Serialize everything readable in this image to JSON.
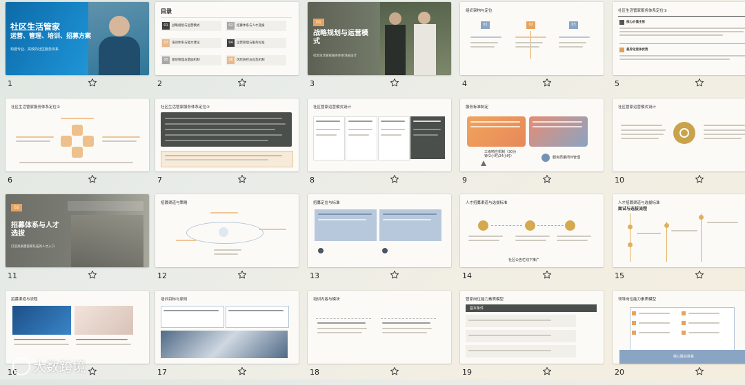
{
  "slides": [
    {
      "n": "1",
      "title": "社区生活管家",
      "subtitle": "运营、管理、培训、招募方案",
      "tag": "构建专业、高效的社区服务体系"
    },
    {
      "n": "2",
      "title": "目录",
      "items": [
        {
          "no": "01",
          "text": "战略规划与运营模式"
        },
        {
          "no": "02",
          "text": "招募体系与人才选拔"
        },
        {
          "no": "03",
          "text": "培训体系与能力建设"
        },
        {
          "no": "04",
          "text": "运营管理与服务标准"
        },
        {
          "no": "05",
          "text": "绩效管理与激励机制"
        },
        {
          "no": "06",
          "text": "风险防控与应急机制"
        }
      ]
    },
    {
      "n": "3",
      "badge": "01",
      "title": "战略规划与运营模式",
      "sub": "社区生活管家服务体系顶层设计"
    },
    {
      "n": "4",
      "title": "组织架构与定位",
      "boxes": [
        "01",
        "02",
        "03"
      ]
    },
    {
      "n": "5",
      "title": "社区生活管家服务体系定位①",
      "h1": "核心价值主张",
      "h2": "差异化竞争优势"
    },
    {
      "n": "6",
      "title": "社区生活管家服务体系定位②"
    },
    {
      "n": "7",
      "title": "社区生活管家服务体系定位③"
    },
    {
      "n": "8",
      "title": "社区管家运营模式设计"
    },
    {
      "n": "9",
      "title": "服务标准制定",
      "l1": "三级响应机制（30分钟/2小时/24小时）",
      "l2": "服务质量闭环管理"
    },
    {
      "n": "10",
      "title": "社区管家运营模式设计"
    },
    {
      "n": "11",
      "badge": "02",
      "title": "招募体系与人才选拔",
      "sub": "打造高质量管家队伍的人才入口"
    },
    {
      "n": "12",
      "title": "招募渠道与策略"
    },
    {
      "n": "13",
      "title": "招募定位与标准"
    },
    {
      "n": "14",
      "title": "人才招募渠道与选拔标准",
      "footer": "社区公告栏线下推广"
    },
    {
      "n": "15",
      "title": "人才招募渠道与选拔标准",
      "sub": "面试与选拔流程"
    },
    {
      "n": "16",
      "title": "招募渠道与流程"
    },
    {
      "n": "17",
      "title": "培训目标与原则"
    },
    {
      "n": "18",
      "title": "培训内容与模块"
    },
    {
      "n": "19",
      "title": "管家岗位能力素质模型",
      "h": "基本条件"
    },
    {
      "n": "20",
      "title": "领导岗位能力素质模型",
      "footer": "核心胜任体系"
    }
  ],
  "watermark": "大数跨境",
  "colors": {
    "accent": "#c9a24b",
    "dark": "#4a4f4a",
    "green": "#7d8f6a",
    "orange": "#e7a35e",
    "blue": "#8aa4c3"
  },
  "icons": {
    "bookmark": "star-outline-icon"
  }
}
